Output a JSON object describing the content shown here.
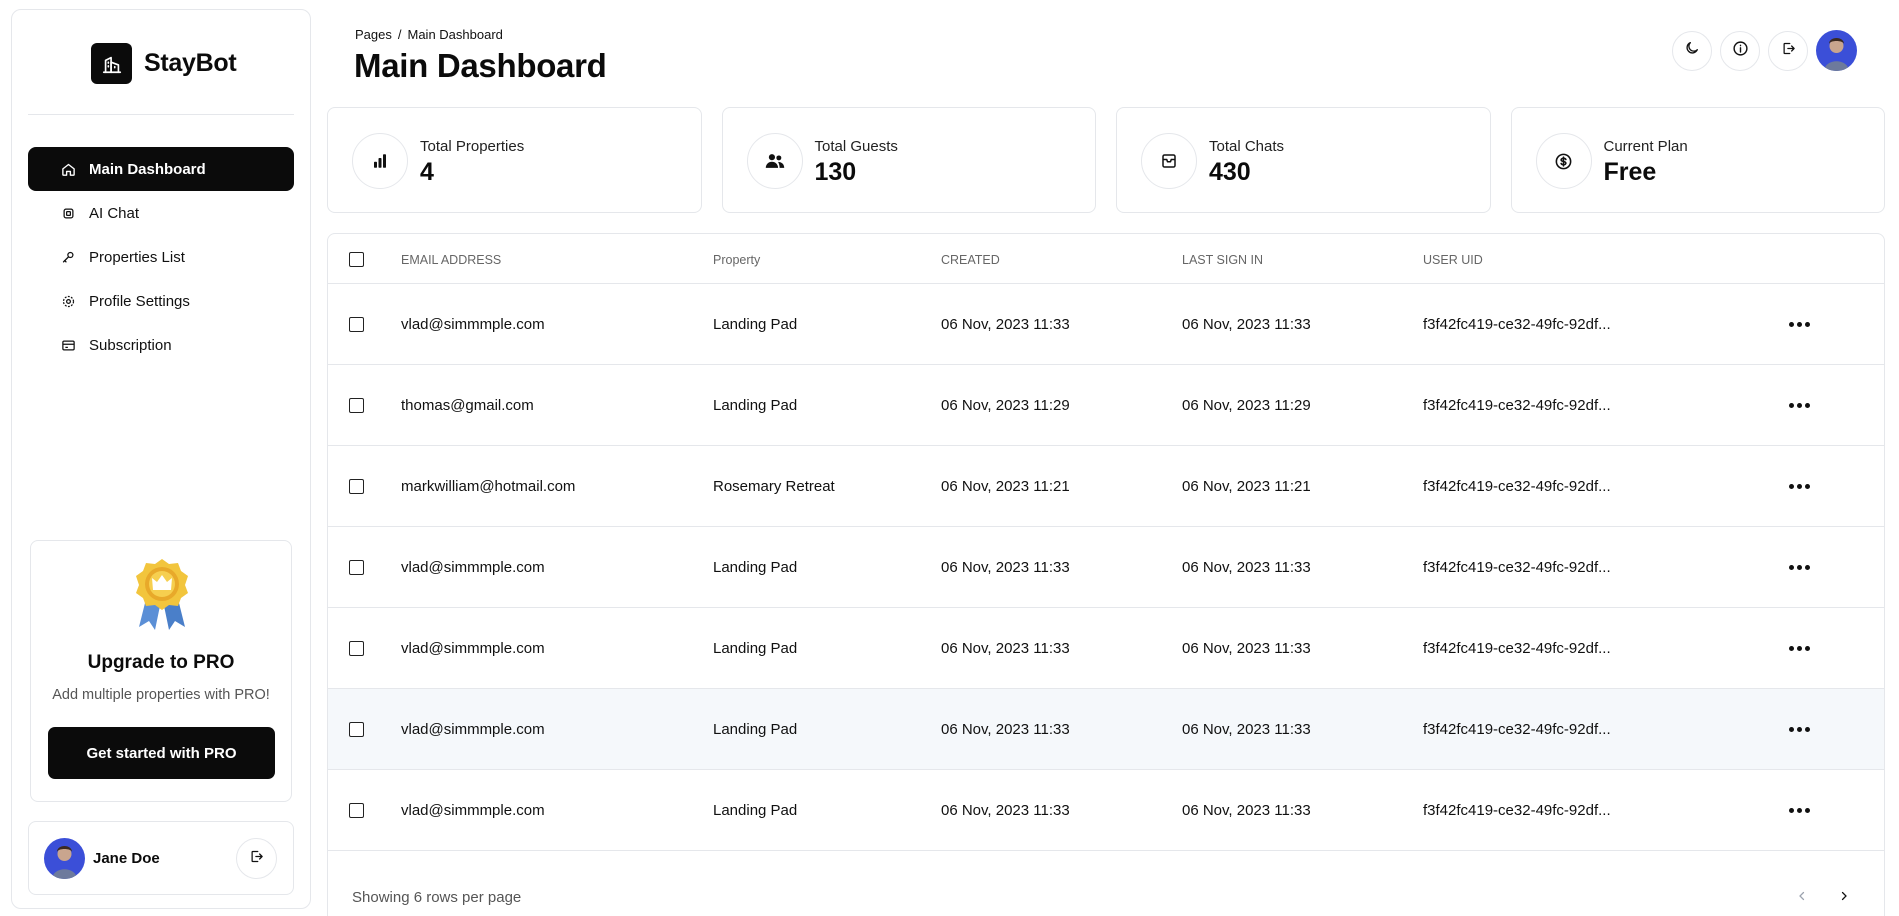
{
  "brand": {
    "name": "StayBot",
    "logo_icon": "building-icon"
  },
  "sidebar": {
    "items": [
      {
        "label": "Main Dashboard",
        "icon": "home-icon",
        "active": true
      },
      {
        "label": "AI Chat",
        "icon": "chip-icon"
      },
      {
        "label": "Properties List",
        "icon": "wrench-icon"
      },
      {
        "label": "Profile Settings",
        "icon": "gear-icon"
      },
      {
        "label": "Subscription",
        "icon": "credit-card-icon"
      }
    ],
    "pro": {
      "title": "Upgrade to PRO",
      "subtitle": "Add multiple properties with PRO!",
      "button": "Get started with PRO"
    },
    "user": {
      "name": "Jane Doe"
    }
  },
  "header": {
    "breadcrumb": [
      "Pages",
      "Main Dashboard"
    ],
    "title": "Main Dashboard"
  },
  "stats": [
    {
      "label": "Total Properties",
      "value": "4",
      "icon": "bar-chart-icon"
    },
    {
      "label": "Total Guests",
      "value": "130",
      "icon": "users-icon"
    },
    {
      "label": "Total Chats",
      "value": "430",
      "icon": "inbox-icon"
    },
    {
      "label": "Current Plan",
      "value": "Free",
      "icon": "dollar-icon"
    }
  ],
  "table": {
    "headers": [
      "EMAIL ADDRESS",
      "Property",
      "CREATED",
      "LAST SIGN IN",
      "USER UID"
    ],
    "rows": [
      [
        "vlad@simmmple.com",
        "Landing Pad",
        "06 Nov, 2023 11:33",
        "06 Nov, 2023 11:33",
        "f3f42fc419-ce32-49fc-92df..."
      ],
      [
        "thomas@gmail.com",
        "Landing Pad",
        "06 Nov, 2023 11:29",
        "06 Nov, 2023 11:29",
        "f3f42fc419-ce32-49fc-92df..."
      ],
      [
        "markwilliam@hotmail.com",
        "Rosemary Retreat",
        "06 Nov, 2023 11:21",
        "06 Nov, 2023 11:21",
        "f3f42fc419-ce32-49fc-92df..."
      ],
      [
        "vlad@simmmple.com",
        "Landing Pad",
        "06 Nov, 2023 11:33",
        "06 Nov, 2023 11:33",
        "f3f42fc419-ce32-49fc-92df..."
      ],
      [
        "vlad@simmmple.com",
        "Landing Pad",
        "06 Nov, 2023 11:33",
        "06 Nov, 2023 11:33",
        "f3f42fc419-ce32-49fc-92df..."
      ],
      [
        "vlad@simmmple.com",
        "Landing Pad",
        "06 Nov, 2023 11:33",
        "06 Nov, 2023 11:33",
        "f3f42fc419-ce32-49fc-92df..."
      ],
      [
        "vlad@simmmple.com",
        "Landing Pad",
        "06 Nov, 2023 11:33",
        "06 Nov, 2023 11:33",
        "f3f42fc419-ce32-49fc-92df..."
      ]
    ],
    "footer": "Showing 6 rows per page"
  },
  "colors": {
    "primary": "#0b0b0b",
    "border": "#e5e7eb",
    "row_highlight": "#f5f8fb"
  }
}
